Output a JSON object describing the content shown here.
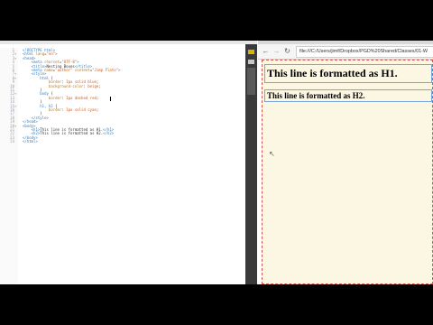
{
  "editor": {
    "lines": [
      {
        "n": "1",
        "html": "<span class='t'>&lt;!DOCTYPE html&gt;</span>"
      },
      {
        "n": "2",
        "html": "<span class='t'>&lt;html</span> <span class='a'>lang</span>=<span class='s'>\"en\"</span><span class='t'>&gt;</span>"
      },
      {
        "n": "3",
        "html": "<span class='t'>&lt;head&gt;</span>"
      },
      {
        "n": "4",
        "html": "    <span class='t'>&lt;meta</span> <span class='a'>charset</span>=<span class='s'>\"UTF-8\"</span><span class='t'>&gt;</span>"
      },
      {
        "n": "5",
        "html": "    <span class='t'>&lt;title&gt;</span><span class='c'>Nesting Boxes</span><span class='t'>&lt;/title&gt;</span>"
      },
      {
        "n": "6",
        "html": "    <span class='t'>&lt;meta</span> <span class='a'>name</span>=<span class='s'>\"author\"</span> <span class='a'>content</span>=<span class='s'>\"Jimp Flato\"</span><span class='t'>&gt;</span>"
      },
      {
        "n": "7",
        "html": "    <span class='t'>&lt;style&gt;</span>"
      },
      {
        "n": "8",
        "html": "        <span class='t'>html</span> {"
      },
      {
        "n": "9",
        "html": "            <span class='a'>border</span>: <span class='s'>1px solid blue</span>;"
      },
      {
        "n": "10",
        "html": "            <span class='a'>background-color</span>: <span class='s'>beige</span>;"
      },
      {
        "n": "11",
        "html": "        }"
      },
      {
        "n": "12",
        "html": "        <span class='t'>body</span> {"
      },
      {
        "n": "13",
        "html": "            <span class='a'>border</span>: <span class='s'>1px dashed red</span>;"
      },
      {
        "n": "14",
        "html": "        }"
      },
      {
        "n": "15",
        "html": "        <span class='t'>h1, h2</span> {"
      },
      {
        "n": "16",
        "html": "            <span class='a'>border</span>: <span class='s'>1px solid cyan</span>;"
      },
      {
        "n": "17",
        "html": "        }"
      },
      {
        "n": "18",
        "html": "    <span class='t'>&lt;/style&gt;</span>"
      },
      {
        "n": "19",
        "html": "<span class='t'>&lt;/head&gt;</span>"
      },
      {
        "n": "20",
        "html": "<span class='t'>&lt;body&gt;</span>"
      },
      {
        "n": "21",
        "html": "    <span class='t'>&lt;h1&gt;</span><span class='c'>This line is formatted as H1.</span><span class='t'>&lt;/h1&gt;</span>"
      },
      {
        "n": "22",
        "html": "    <span class='t'>&lt;h2&gt;</span><span class='c'>This line is formatted as H2.</span><span class='t'>&lt;/h2&gt;</span>"
      },
      {
        "n": "23",
        "html": "<span class='t'>&lt;/body&gt;</span>"
      },
      {
        "n": "24",
        "html": "<span class='t'>&lt;/html&gt;</span>"
      }
    ]
  },
  "browser": {
    "back_icon": "arrow-left-icon",
    "forward_icon": "arrow-right-icon",
    "reload_icon": "reload-icon",
    "url": "file:///C:/Users/jimf/Dropbox/PGD%20Shared/Classes/01-W",
    "h1_text": "This line is formatted as H1.",
    "h2_text": "This line is formatted as H2."
  }
}
